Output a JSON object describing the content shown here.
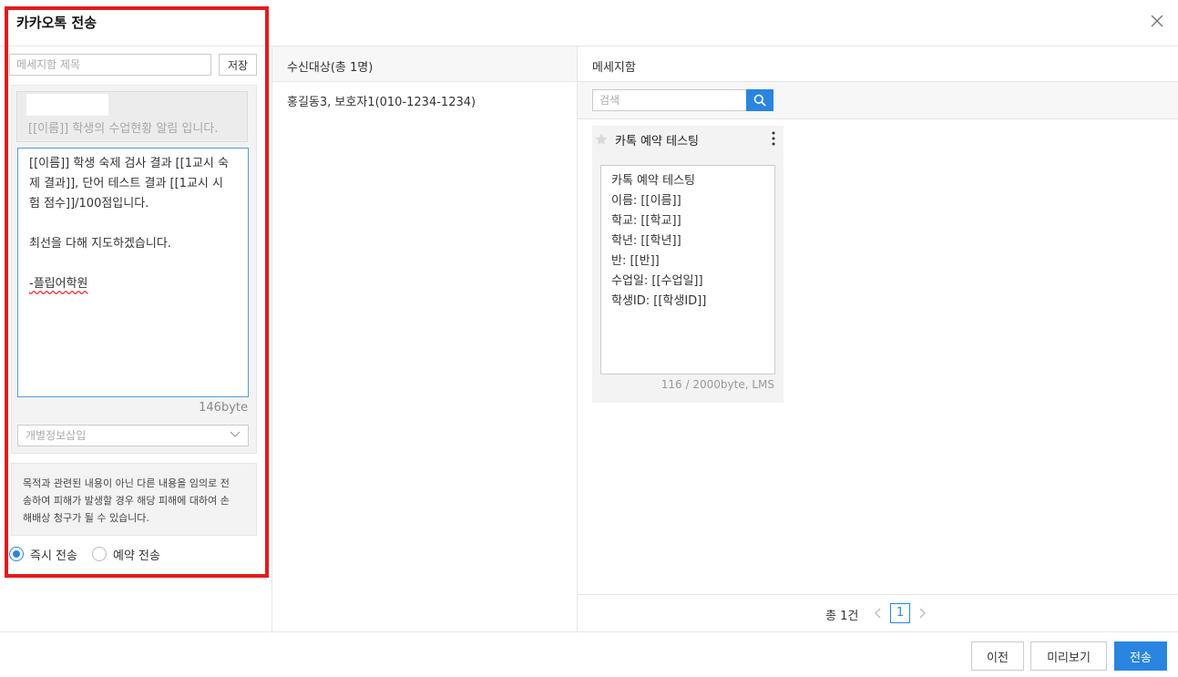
{
  "dialog": {
    "title": "카카오톡 전송"
  },
  "compose": {
    "subject_placeholder": "메세지함 제목",
    "save_label": "저장",
    "preview_text": "[[이름]] 학생의 수업현황 알림 입니다.",
    "body_lines": [
      "[[이름]] 학생 숙제 검사 결과 [[1교시 숙",
      "제 결과]], 단어 테스트 결과 [[1교시 시",
      "험 점수]]/100점입니다.",
      "",
      "최선을 다해 지도하겠습니다.",
      "",
      "-플립어학원"
    ],
    "byte_count": "146byte",
    "insert_placeholder": "개별정보삽입",
    "notice_lines": [
      "목적과 관련된 내용이 아닌 다른 내용을 임의로 전",
      "송하여 피해가 발생할 경우 해당 피해에 대하여 손",
      "해배상 청구가 될 수 있습니다."
    ],
    "send_mode": {
      "immediate": "즉시 전송",
      "scheduled": "예약 전송",
      "selected": "immediate"
    }
  },
  "recipients": {
    "header": "수신대상(총 1명)",
    "items": [
      "홍길동3, 보호자1(010-1234-1234)"
    ]
  },
  "message_box": {
    "header": "메세지함",
    "search_placeholder": "검색",
    "template": {
      "title": "카톡 예약 테스팅",
      "body_lines": [
        "카톡 예약 테스팅",
        "이름: [[이름]]",
        "학교: [[학교]]",
        "학년: [[학년]]",
        "반: [[반]]",
        "수업일: [[수업일]]",
        "학생ID: [[학생ID]]"
      ],
      "bytes": "116 / 2000byte, LMS"
    },
    "pagination": {
      "total": "총 1건",
      "current_page": "1"
    }
  },
  "footer": {
    "prev_label": "이전",
    "preview_label": "미리보기",
    "send_label": "전송"
  },
  "colors": {
    "accent": "#2a85e0",
    "highlight_frame": "#e21b1b"
  }
}
